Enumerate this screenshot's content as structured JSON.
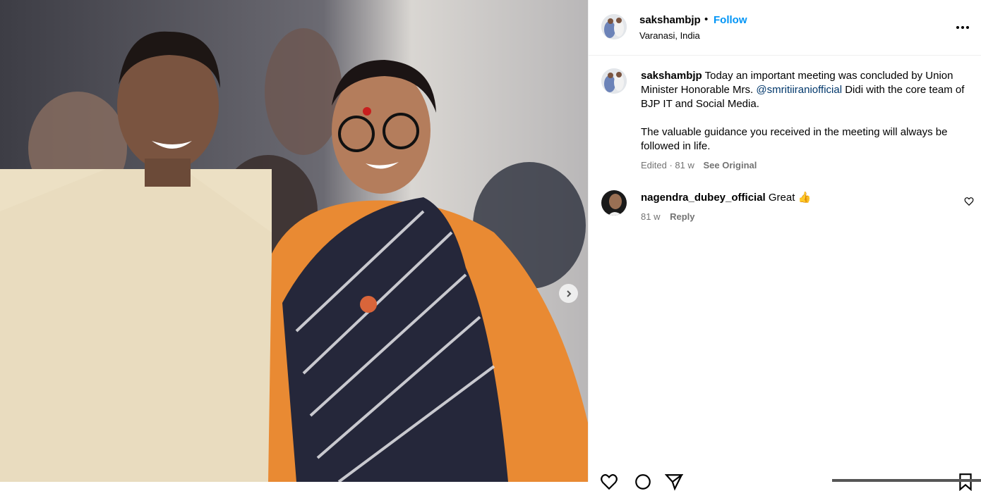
{
  "post": {
    "username": "sakshambjp",
    "separator": "•",
    "follow_label": "Follow",
    "location": "Varanasi, India"
  },
  "caption": {
    "username": "sakshambjp",
    "text_before": "Today an important meeting was concluded by Union Minister Honorable Mrs.",
    "mention": "@smritiiraniofficial",
    "text_after": "Didi with the core team of BJP IT and Social Media.",
    "paragraph2": "The valuable guidance you received in the meeting will always be followed in life.",
    "edited": "Edited · 81 w",
    "see_original": "See Original"
  },
  "comment": {
    "username": "nagendra_dubey_official",
    "text": "Great 👍",
    "time": "81 w",
    "reply_label": "Reply"
  },
  "colors": {
    "accent": "#0095f6",
    "mention": "#00376b",
    "muted": "#737373"
  },
  "icons": [
    "chevron-right-icon",
    "more-icon",
    "heart-icon",
    "comment-icon",
    "share-icon",
    "bookmark-icon"
  ]
}
